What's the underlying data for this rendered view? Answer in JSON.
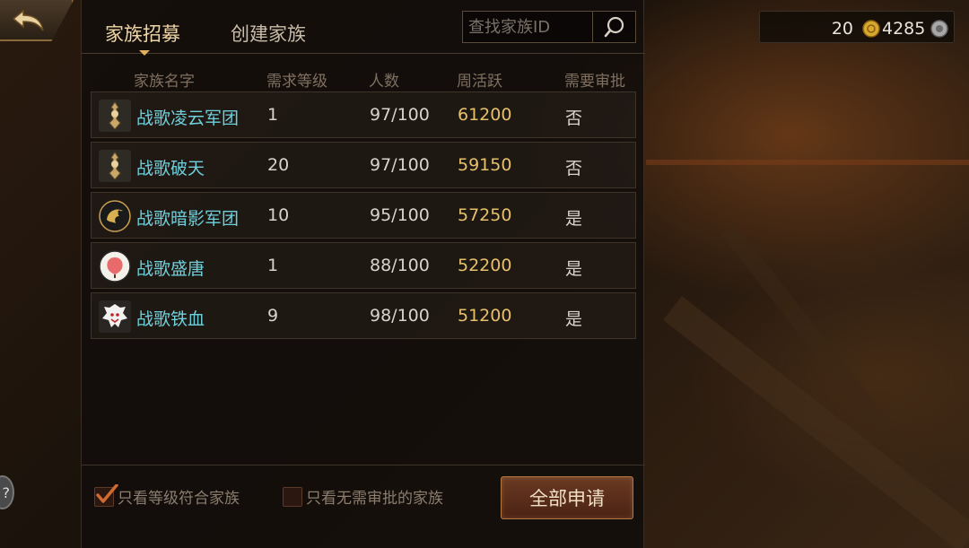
{
  "tabs": [
    {
      "label": "家族招募",
      "active": true
    },
    {
      "label": "创建家族",
      "active": false
    }
  ],
  "search": {
    "placeholder": "查找家族ID",
    "icon": "search-icon"
  },
  "table": {
    "headers": {
      "name": "家族名字",
      "level": "需求等级",
      "count": "人数",
      "activity": "周活跃",
      "approval": "需要审批"
    },
    "rows": [
      {
        "name": "战歌凌云军团",
        "level": "1",
        "count": "97/100",
        "activity": "61200",
        "approval": "否",
        "emblem": "trophy-emblem"
      },
      {
        "name": "战歌破天",
        "level": "20",
        "count": "97/100",
        "activity": "59150",
        "approval": "否",
        "emblem": "trophy-emblem"
      },
      {
        "name": "战歌暗影军团",
        "level": "10",
        "count": "95/100",
        "activity": "57250",
        "approval": "是",
        "emblem": "dragon-emblem"
      },
      {
        "name": "战歌盛唐",
        "level": "1",
        "count": "88/100",
        "activity": "52200",
        "approval": "是",
        "emblem": "fan-emblem"
      },
      {
        "name": "战歌铁血",
        "level": "9",
        "count": "98/100",
        "activity": "51200",
        "approval": "是",
        "emblem": "beast-emblem"
      }
    ]
  },
  "filters": {
    "level_match": {
      "label": "只看等级符合家族",
      "checked": true
    },
    "no_approval": {
      "label": "只看无需审批的家族",
      "checked": false
    }
  },
  "apply_all_label": "全部申请",
  "currency": {
    "gold": "20",
    "silver": "4285"
  },
  "help_label": "?",
  "colors": {
    "name": "#6fd0dc",
    "activity": "#e7c06c",
    "accent": "#e0b060"
  }
}
